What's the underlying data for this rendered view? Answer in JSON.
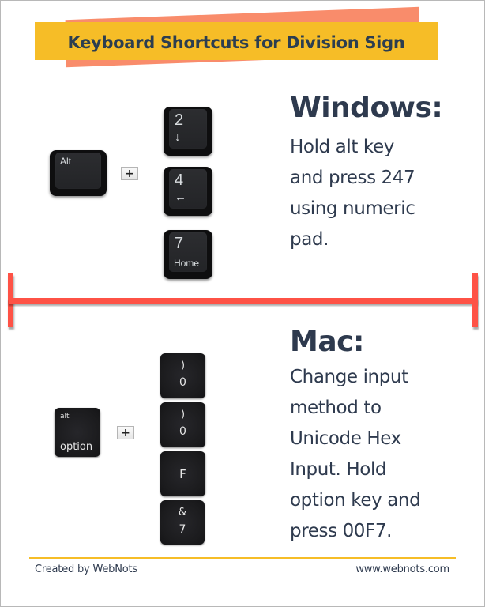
{
  "title": "Keyboard Shortcuts for Division Sign",
  "colors": {
    "banner": "#f6bd27",
    "banner_shadow": "#f98c6b",
    "text": "#2e3a4e",
    "divider": "#fe5246",
    "footer_rule": "#f6bd27"
  },
  "windows": {
    "heading": "Windows:",
    "description": "Hold alt key\nand press 247\nusing numeric\npad.",
    "modifier_key": "Alt",
    "plus": "+",
    "keys": [
      {
        "main": "2",
        "sub": "↓"
      },
      {
        "main": "4",
        "sub": "←"
      },
      {
        "main": "7",
        "sub": "Home"
      }
    ]
  },
  "mac": {
    "heading": "Mac:",
    "description": "Change input\nmethod to\nUnicode Hex\nInput. Hold\noption key and\npress 00F7.",
    "modifier_key": {
      "top": "alt",
      "bottom": "option"
    },
    "plus": "+",
    "keys": [
      {
        "top": ")",
        "bottom": "0"
      },
      {
        "top": ")",
        "bottom": "0"
      },
      {
        "single": "F"
      },
      {
        "top": "&",
        "bottom": "7"
      }
    ]
  },
  "footer": {
    "left": "Created by WebNots",
    "right": "www.webnots.com"
  },
  "icons": {
    "divider": "horizontal-bar-with-end-caps",
    "arrow_down": "arrow-down-icon",
    "arrow_left": "arrow-left-icon"
  }
}
